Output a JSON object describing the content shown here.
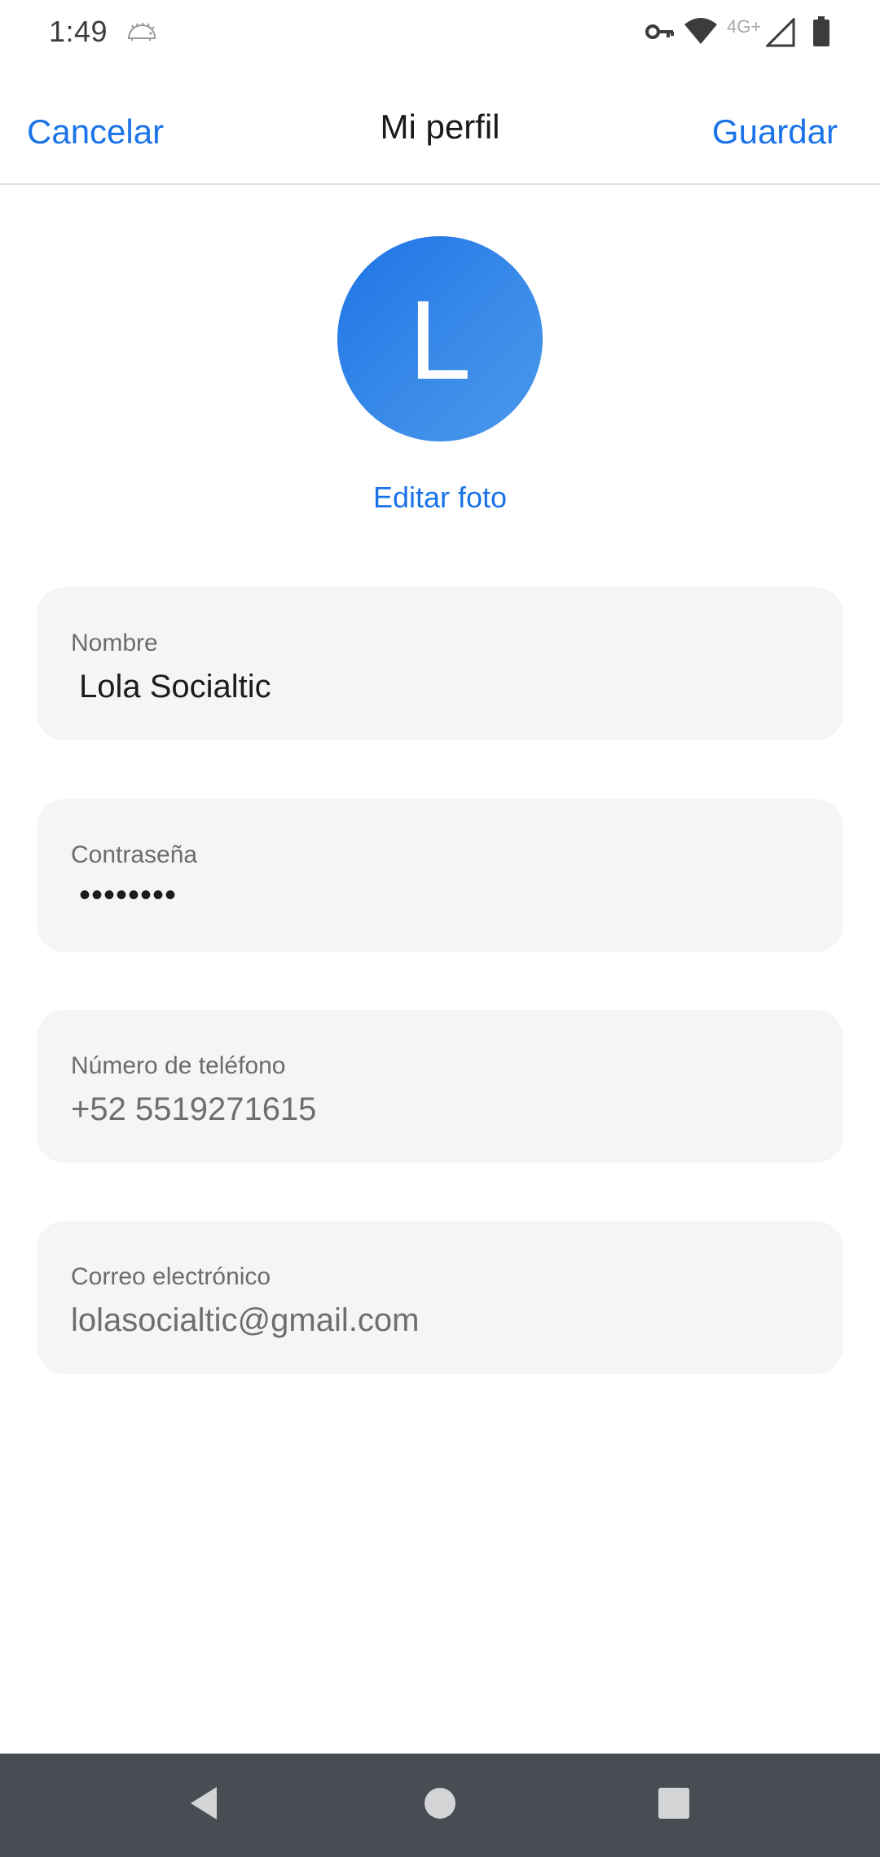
{
  "status_bar": {
    "time": "1:49",
    "network_label": "4G+",
    "icons": [
      "hedgehog-icon",
      "vpn-key-icon",
      "wifi-icon",
      "cell-signal-icon",
      "battery-icon"
    ]
  },
  "header": {
    "cancel_label": "Cancelar",
    "title": "Mi perfil",
    "save_label": "Guardar"
  },
  "profile": {
    "avatar_letter": "L",
    "edit_photo_label": "Editar foto"
  },
  "fields": {
    "name": {
      "label": "Nombre",
      "value": "Lola Socialtic"
    },
    "password": {
      "label": "Contraseña",
      "value": "••••••••"
    },
    "phone": {
      "label": "Número de teléfono",
      "value": "+52 5519271615"
    },
    "email": {
      "label": "Correo electrónico",
      "value": "lolasocialtic@gmail.com"
    }
  },
  "navigation": {
    "icons": [
      "back-icon",
      "home-icon",
      "recents-icon"
    ]
  },
  "colors": {
    "accent": "#1a73e8",
    "avatar": "#2f80e8",
    "field_background": "#f5f5f4",
    "nav_bar": "#474d53"
  }
}
